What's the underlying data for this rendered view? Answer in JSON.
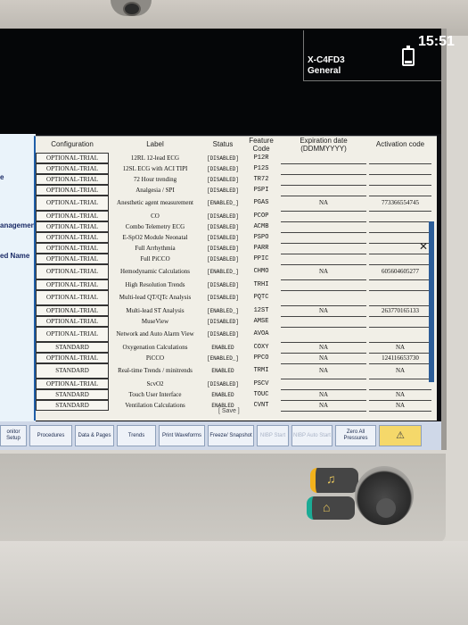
{
  "header": {
    "patient_id": "X-C4FD3",
    "category": "General",
    "time": "15:51"
  },
  "left_labels": [
    "e",
    "anagement",
    "ed Name"
  ],
  "table": {
    "headers": [
      "Configuration",
      "Label",
      "Status",
      "Feature Code",
      "Expiration date (DDMMYYYY)",
      "Activation code"
    ],
    "rows": [
      {
        "cfg": "OPTIONAL-TRIAL",
        "label": "12RL 12-lead ECG",
        "status": "[DISABLED]",
        "code": "P12R",
        "exp": "",
        "act": ""
      },
      {
        "cfg": "OPTIONAL-TRIAL",
        "label": "12SL ECG with ACI TIPI",
        "status": "[DISABLED]",
        "code": "P12S",
        "exp": "",
        "act": ""
      },
      {
        "cfg": "OPTIONAL-TRIAL",
        "label": "72 Hour trending",
        "status": "[DISABLED]",
        "code": "TR72",
        "exp": "",
        "act": ""
      },
      {
        "cfg": "OPTIONAL-TRIAL",
        "label": "Analgesia / SPI",
        "status": "[DISABLED]",
        "code": "PSPI",
        "exp": "",
        "act": ""
      },
      {
        "cfg": "OPTIONAL-TRIAL",
        "label": "Anesthetic agent measurement",
        "status": "[ENABLED_]",
        "code": "PGAS",
        "exp": "NA",
        "act": "773366554745"
      },
      {
        "cfg": "OPTIONAL-TRIAL",
        "label": "CO",
        "status": "[DISABLED]",
        "code": "PCOP",
        "exp": "",
        "act": ""
      },
      {
        "cfg": "OPTIONAL-TRIAL",
        "label": "Combo Telemetry ECG",
        "status": "[DISABLED]",
        "code": "ACMB",
        "exp": "",
        "act": ""
      },
      {
        "cfg": "OPTIONAL-TRIAL",
        "label": "E-SpO2 Module Neonatal",
        "status": "[DISABLED]",
        "code": "PSPO",
        "exp": "",
        "act": ""
      },
      {
        "cfg": "OPTIONAL-TRIAL",
        "label": "Full Arrhythmia",
        "status": "[DISABLED]",
        "code": "PARR",
        "exp": "",
        "act": ""
      },
      {
        "cfg": "OPTIONAL-TRIAL",
        "label": "Full PiCCO",
        "status": "[DISABLED]",
        "code": "PPIC",
        "exp": "",
        "act": ""
      },
      {
        "cfg": "OPTIONAL-TRIAL",
        "label": "Hemodynamic Calculations",
        "status": "[ENABLED_]",
        "code": "CHMO",
        "exp": "NA",
        "act": "605604605277"
      },
      {
        "cfg": "OPTIONAL-TRIAL",
        "label": "High Resolution Trends",
        "status": "[DISABLED]",
        "code": "TRHI",
        "exp": "",
        "act": ""
      },
      {
        "cfg": "OPTIONAL-TRIAL",
        "label": "Multi-lead QT/QTc Analysis",
        "status": "[DISABLED]",
        "code": "PQTC",
        "exp": "",
        "act": ""
      },
      {
        "cfg": "OPTIONAL-TRIAL",
        "label": "Multi-lead ST Analysis",
        "status": "[ENABLED_]",
        "code": "12ST",
        "exp": "NA",
        "act": "263770165133"
      },
      {
        "cfg": "OPTIONAL-TRIAL",
        "label": "MuseView",
        "status": "[DISABLED]",
        "code": "AMSE",
        "exp": "",
        "act": ""
      },
      {
        "cfg": "OPTIONAL-TRIAL",
        "label": "Network and Auto Alarm View",
        "status": "[DISABLED]",
        "code": "AVOA",
        "exp": "",
        "act": ""
      },
      {
        "cfg": "STANDARD",
        "label": "Oxygenation Calculations",
        "status": "ENABLED",
        "code": "COXY",
        "exp": "NA",
        "act": "NA"
      },
      {
        "cfg": "OPTIONAL-TRIAL",
        "label": "PiCCO",
        "status": "[ENABLED_]",
        "code": "PPCO",
        "exp": "NA",
        "act": "124116653730"
      },
      {
        "cfg": "STANDARD",
        "label": "Real-time Trends / minitrends",
        "status": "ENABLED",
        "code": "TRMI",
        "exp": "NA",
        "act": "NA"
      },
      {
        "cfg": "OPTIONAL-TRIAL",
        "label": "ScvO2",
        "status": "[DISABLED]",
        "code": "PSCV",
        "exp": "",
        "act": ""
      },
      {
        "cfg": "STANDARD",
        "label": "Touch User Interface",
        "status": "ENABLED",
        "code": "TOUC",
        "exp": "NA",
        "act": "NA"
      },
      {
        "cfg": "STANDARD",
        "label": "Ventilation Calculations",
        "status": "ENABLED",
        "code": "CVNT",
        "exp": "NA",
        "act": "NA"
      }
    ],
    "save_label": "[ Save ]"
  },
  "toolbar": [
    {
      "label": "onitor Setup",
      "state": "normal"
    },
    {
      "label": "Procedures",
      "state": "normal"
    },
    {
      "label": "Data & Pages",
      "state": "normal"
    },
    {
      "label": "Trends",
      "state": "normal"
    },
    {
      "label": "Print Waveforms",
      "state": "normal"
    },
    {
      "label": "Freeze/ Snapshot",
      "state": "normal"
    },
    {
      "label": "NIBP Start",
      "state": "dim"
    },
    {
      "label": "NIBP Auto Start",
      "state": "dim"
    },
    {
      "label": "Zero All Pressures",
      "state": "normal"
    },
    {
      "label": "⚠",
      "state": "alarm"
    }
  ]
}
